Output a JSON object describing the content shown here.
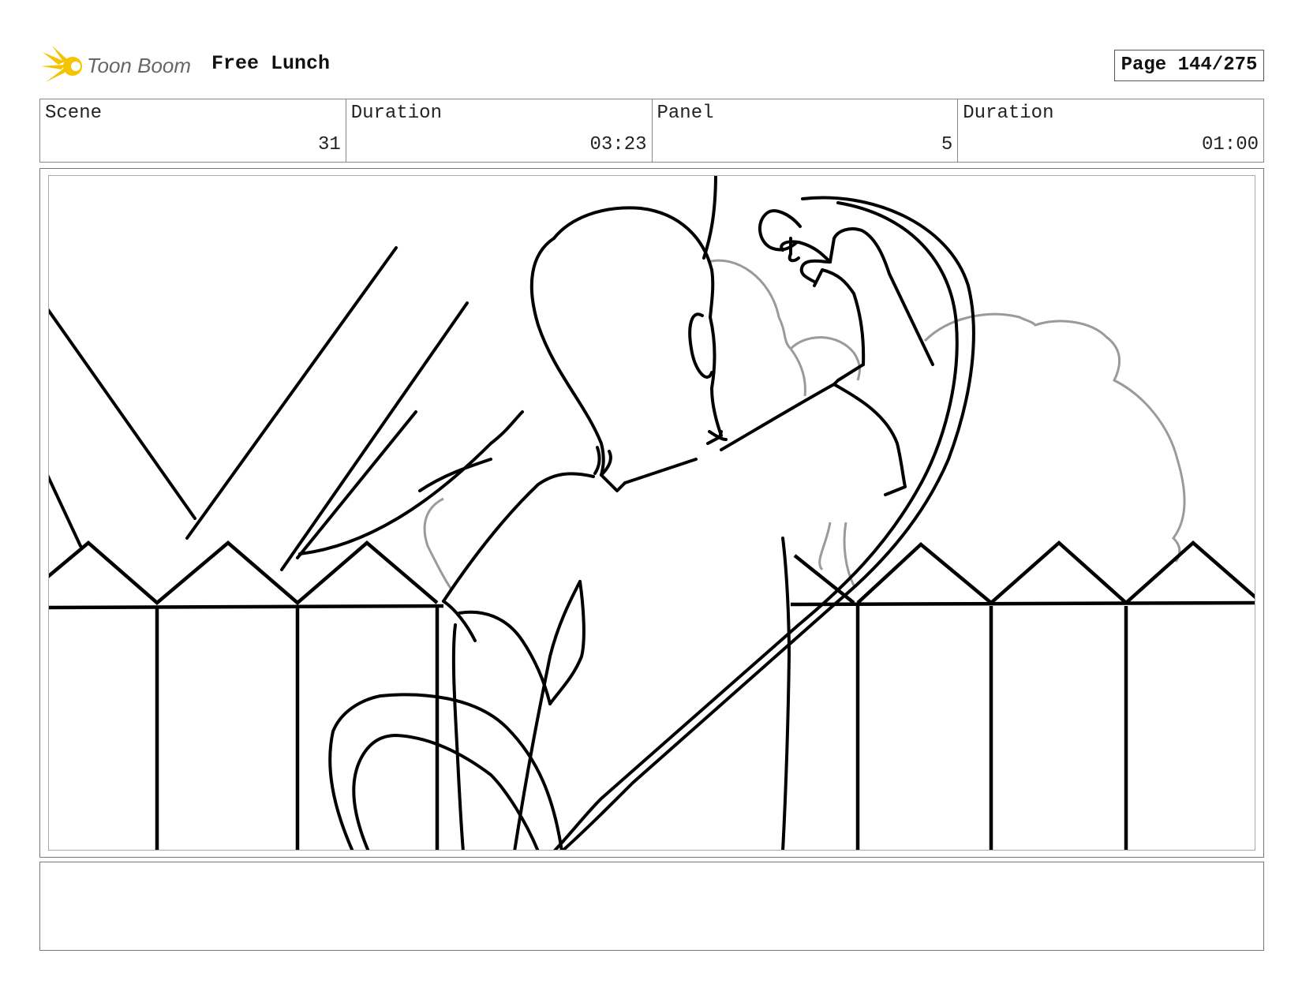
{
  "header": {
    "logo_text": "Toon Boom",
    "project_title": "Free Lunch",
    "page_label": "Page 144/275"
  },
  "info": {
    "scene_label": "Scene",
    "scene_value": "31",
    "scene_duration_label": "Duration",
    "scene_duration_value": "03:23",
    "panel_label": "Panel",
    "panel_value": "5",
    "panel_duration_label": "Duration",
    "panel_duration_value": "01:00"
  },
  "colors": {
    "logo_yellow": "#f5c400",
    "line_black": "#000000",
    "bush_gray": "#9a9a9a"
  },
  "notes": {
    "text": ""
  }
}
